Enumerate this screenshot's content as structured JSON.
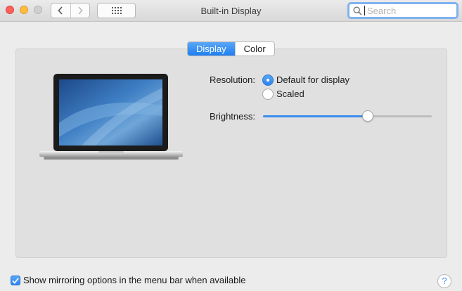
{
  "window": {
    "title": "Built-in Display"
  },
  "toolbar": {
    "back_icon": "chevron-left-icon",
    "forward_icon": "chevron-right-icon",
    "show_all_icon": "grid-icon"
  },
  "search": {
    "placeholder": "Search",
    "value": ""
  },
  "tabs": [
    {
      "label": "Display",
      "active": true
    },
    {
      "label": "Color",
      "active": false
    }
  ],
  "display": {
    "resolution_label": "Resolution:",
    "resolution_options": [
      {
        "label": "Default for display",
        "selected": true
      },
      {
        "label": "Scaled",
        "selected": false
      }
    ],
    "brightness_label": "Brightness:",
    "brightness_level": 0.62
  },
  "footer": {
    "mirroring_label": "Show mirroring options in the menu bar when available",
    "mirroring_checked": true,
    "help_label": "?"
  },
  "colors": {
    "accent": "#3b8cee"
  }
}
